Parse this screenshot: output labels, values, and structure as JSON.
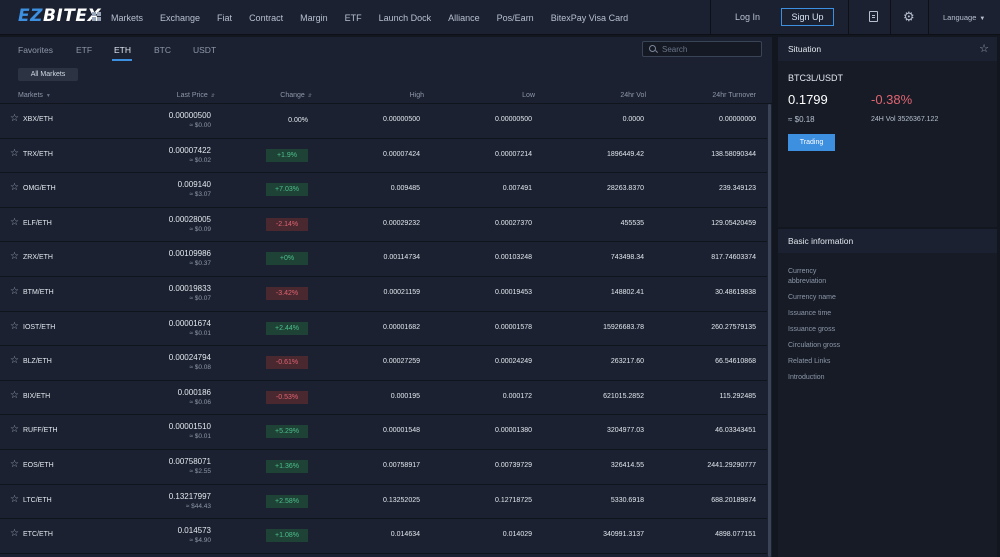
{
  "header": {
    "logo_a": "EZ",
    "logo_b": "BITEX",
    "nav": [
      "Markets",
      "Exchange",
      "Fiat",
      "Contract",
      "Margin",
      "ETF",
      "Launch Dock",
      "Alliance",
      "Pos/Earn",
      "BitexPay Visa Card"
    ],
    "login": "Log In",
    "signup": "Sign Up",
    "language": "Language"
  },
  "tabs": [
    "Favorites",
    "ETF",
    "ETH",
    "BTC",
    "USDT"
  ],
  "active_tab": "ETH",
  "search": {
    "placeholder": "Search"
  },
  "all_markets": "All Markets",
  "columns": {
    "markets": "Markets",
    "last_price": "Last Price",
    "change": "Change",
    "high": "High",
    "low": "Low",
    "vol": "24hr Vol",
    "turnover": "24hr Turnover"
  },
  "rows": [
    {
      "pair": "XBX/ETH",
      "price": "0.00000500",
      "fiat": "≈ $0.00",
      "change": "0.00%",
      "dir": "flat",
      "high": "0.00000500",
      "low": "0.00000500",
      "vol": "0.0000",
      "turnover": "0.00000000"
    },
    {
      "pair": "TRX/ETH",
      "price": "0.00007422",
      "fiat": "≈ $0.02",
      "change": "+1.9%",
      "dir": "up",
      "high": "0.00007424",
      "low": "0.00007214",
      "vol": "1896449.42",
      "turnover": "138.58090344"
    },
    {
      "pair": "OMG/ETH",
      "price": "0.009140",
      "fiat": "≈ $3.07",
      "change": "+7.03%",
      "dir": "up",
      "high": "0.009485",
      "low": "0.007491",
      "vol": "28263.8370",
      "turnover": "239.349123"
    },
    {
      "pair": "ELF/ETH",
      "price": "0.00028005",
      "fiat": "≈ $0.09",
      "change": "-2.14%",
      "dir": "down",
      "high": "0.00029232",
      "low": "0.00027370",
      "vol": "455535",
      "turnover": "129.05420459"
    },
    {
      "pair": "ZRX/ETH",
      "price": "0.00109986",
      "fiat": "≈ $0.37",
      "change": "+0%",
      "dir": "up",
      "high": "0.00114734",
      "low": "0.00103248",
      "vol": "743498.34",
      "turnover": "817.74603374"
    },
    {
      "pair": "BTM/ETH",
      "price": "0.00019833",
      "fiat": "≈ $0.07",
      "change": "-3.42%",
      "dir": "down",
      "high": "0.00021159",
      "low": "0.00019453",
      "vol": "148802.41",
      "turnover": "30.48619838"
    },
    {
      "pair": "IOST/ETH",
      "price": "0.00001674",
      "fiat": "≈ $0.01",
      "change": "+2.44%",
      "dir": "up",
      "high": "0.00001682",
      "low": "0.00001578",
      "vol": "15926683.78",
      "turnover": "260.27579135"
    },
    {
      "pair": "BLZ/ETH",
      "price": "0.00024794",
      "fiat": "≈ $0.08",
      "change": "-0.61%",
      "dir": "down",
      "high": "0.00027259",
      "low": "0.00024249",
      "vol": "263217.60",
      "turnover": "66.54610868"
    },
    {
      "pair": "BIX/ETH",
      "price": "0.000186",
      "fiat": "≈ $0.06",
      "change": "-0.53%",
      "dir": "down",
      "high": "0.000195",
      "low": "0.000172",
      "vol": "621015.2852",
      "turnover": "115.292485"
    },
    {
      "pair": "RUFF/ETH",
      "price": "0.00001510",
      "fiat": "≈ $0.01",
      "change": "+5.29%",
      "dir": "up",
      "high": "0.00001548",
      "low": "0.00001380",
      "vol": "3204977.03",
      "turnover": "46.03343451"
    },
    {
      "pair": "EOS/ETH",
      "price": "0.00758071",
      "fiat": "≈ $2.55",
      "change": "+1.36%",
      "dir": "up",
      "high": "0.00758917",
      "low": "0.00739729",
      "vol": "326414.55",
      "turnover": "2441.29290777"
    },
    {
      "pair": "LTC/ETH",
      "price": "0.13217997",
      "fiat": "≈ $44.43",
      "change": "+2.58%",
      "dir": "up",
      "high": "0.13252025",
      "low": "0.12718725",
      "vol": "5330.6918",
      "turnover": "688.20189874"
    },
    {
      "pair": "ETC/ETH",
      "price": "0.014573",
      "fiat": "≈ $4.90",
      "change": "+1.08%",
      "dir": "up",
      "high": "0.014634",
      "low": "0.014029",
      "vol": "340991.3137",
      "turnover": "4898.077151"
    }
  ],
  "situation": {
    "title": "Situation",
    "symbol": "BTC3L/USDT",
    "price": "0.1799",
    "change": "-0.38%",
    "fiat": "≈ $0.18",
    "vol": "24H Vol 3526367.122",
    "trading": "Trading"
  },
  "basic": {
    "title": "Basic information",
    "items": [
      "Currency abbreviation",
      "Currency name",
      "Issuance time",
      "Issuance gross",
      "Circulation gross",
      "Related Links",
      "Introduction"
    ]
  },
  "colors": {
    "accent": "#3d8fe0",
    "up": "#4bc08a",
    "down": "#e06470",
    "panel": "#1b2130"
  }
}
